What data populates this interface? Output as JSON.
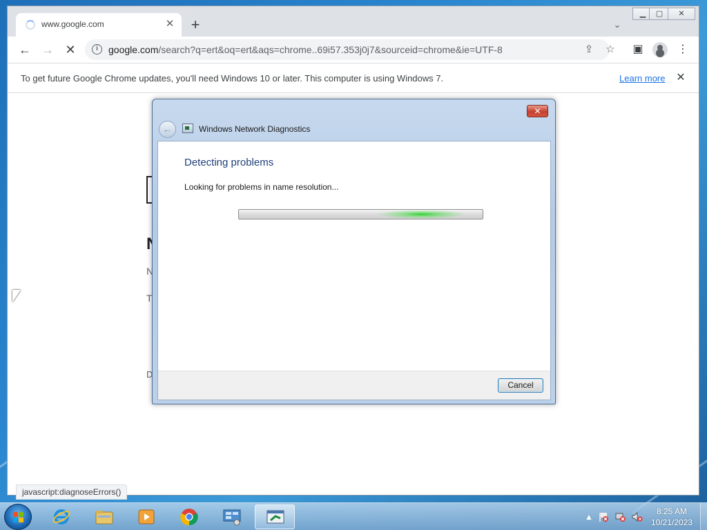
{
  "browser": {
    "tab_title": "www.google.com",
    "tab_close": "✕",
    "new_tab": "+",
    "tab_search": "⌄",
    "window_controls": {
      "minimize": "▁",
      "maximize": "▢",
      "close": "✕"
    },
    "url_host": "google.com",
    "url_rest": "/search?q=ert&oq=ert&aqs=chrome..69i57.353j0j7&sourceid=chrome&ie=UTF-8",
    "info_glyph": "i",
    "back": "←",
    "forward": "→",
    "reload": "✕",
    "share": "⇪",
    "bookmark": "☆",
    "sidepanel": "▣",
    "menu": "⋮",
    "icons": [
      "info-icon",
      "share-icon",
      "star-icon",
      "side-panel-icon",
      "avatar-icon",
      "menu-icon"
    ]
  },
  "infobar": {
    "message": "To get future Google Chrome updates, you'll need Windows 10 or later. This computer is using Windows 7.",
    "learn_more": "Learn more",
    "close": "✕"
  },
  "page_fragments": {
    "big_letter": "N",
    "n_line": "N",
    "t_line": "T",
    "d_line": "D"
  },
  "status_url": "javascript:diagnoseErrors()",
  "dialog": {
    "title": "Windows Network Diagnostics",
    "close": "✕",
    "back": "←",
    "heading": "Detecting problems",
    "subtext": "Looking for problems in name resolution...",
    "cancel": "Cancel",
    "progress_state": "indeterminate"
  },
  "taskbar": {
    "items": [
      "internet-explorer",
      "windows-explorer",
      "media-player",
      "google-chrome",
      "network-connections",
      "network-diagnostics"
    ],
    "time": "8:25 AM",
    "date": "10/21/2023",
    "tray_chevron": "▲"
  },
  "colors": {
    "chrome_blue": "#1a73e8",
    "dialog_heading": "#1e3f7a",
    "progress_green": "#28d228"
  }
}
